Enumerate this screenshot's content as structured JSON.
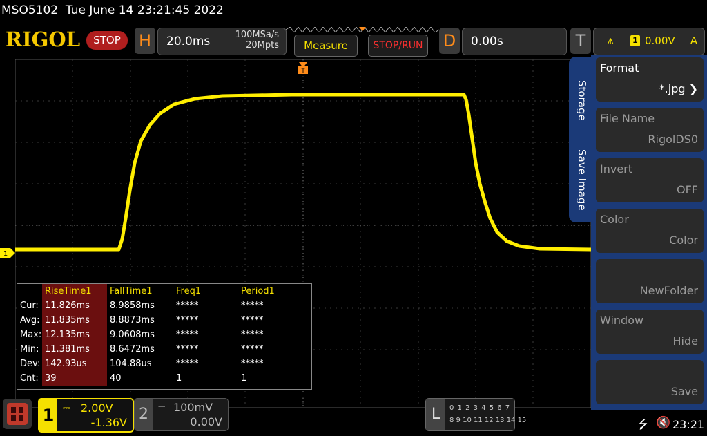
{
  "header": {
    "model": "MSO5102",
    "datetime": "Tue June 14 23:21:45 2022",
    "logo": "RIGOL",
    "run_state": "STOP",
    "horizontal_key": "H",
    "timebase": "20.0ms",
    "sample_rate": "100MSa/s",
    "memory_depth": "20Mpts",
    "measure_label": "Measure",
    "stop_run_label": "STOP/RUN",
    "delay_key": "D",
    "delay": "0.00s",
    "trigger_key": "T",
    "trigger_channel": "1",
    "trigger_level": "0.00V",
    "trigger_mode": "A"
  },
  "waveform": {
    "channel_marker": "1",
    "color": "#ffee00"
  },
  "measurements": {
    "columns": [
      "RiseTime1",
      "FallTime1",
      "Freq1",
      "Period1"
    ],
    "rows": [
      {
        "label": "Cur:",
        "values": [
          "11.826ms",
          "8.9858ms",
          "*****",
          "*****"
        ]
      },
      {
        "label": "Avg:",
        "values": [
          "11.835ms",
          "8.8873ms",
          "*****",
          "*****"
        ]
      },
      {
        "label": "Max:",
        "values": [
          "12.135ms",
          "9.0608ms",
          "*****",
          "*****"
        ]
      },
      {
        "label": "Min:",
        "values": [
          "11.381ms",
          "8.6472ms",
          "*****",
          "*****"
        ]
      },
      {
        "label": "Dev:",
        "values": [
          "142.93us",
          "104.88us",
          "*****",
          "*****"
        ]
      },
      {
        "label": "Cnt:",
        "values": [
          "39",
          "40",
          "1",
          "1"
        ]
      }
    ]
  },
  "side_menu": {
    "tab1": "Storage",
    "tab2": "Save Image",
    "items": [
      {
        "key": "Format",
        "value": "*.jpg"
      },
      {
        "key": "File Name",
        "value": "RigolDS0"
      },
      {
        "key": "Invert",
        "value": "OFF"
      },
      {
        "key": "Color",
        "value": "Color"
      },
      {
        "key": "",
        "value": "NewFolder"
      },
      {
        "key": "Window",
        "value": "Hide"
      },
      {
        "key": "",
        "value": "Save"
      }
    ]
  },
  "channels": {
    "ch1": {
      "num": "1",
      "scale": "2.00V",
      "offset": "-1.36V",
      "coupling": "DC"
    },
    "ch2": {
      "num": "2",
      "scale": "100mV",
      "offset": "0.00V",
      "coupling": "DC"
    }
  },
  "logic": {
    "key": "L",
    "row1": "0 1 2 3  4 5 6 7",
    "row2": "8 9 10 11 12 13 14 15"
  },
  "status": {
    "clock": "23:21"
  },
  "colors": {
    "accent": "#f5e000",
    "menu_blue": "#1b3a78",
    "horizontal_orange": "#ff8c1a",
    "stop_red": "#b01e1e"
  }
}
